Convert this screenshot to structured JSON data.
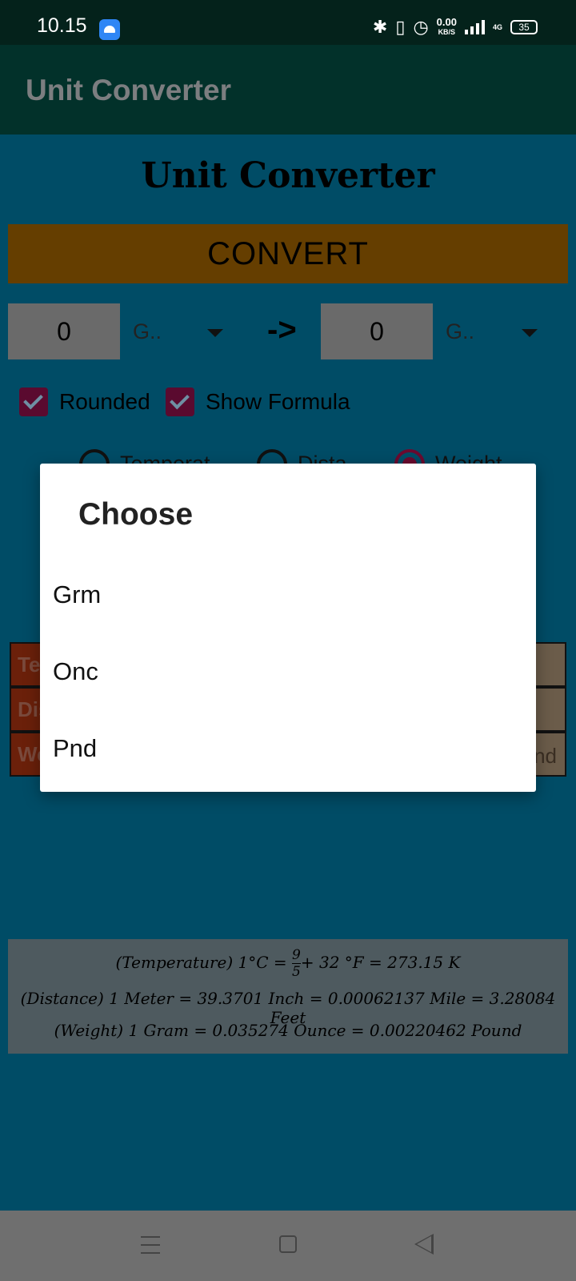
{
  "status_bar": {
    "time": "10.15",
    "speed_value": "0.00",
    "speed_unit": "KB/S",
    "network": "4G",
    "battery": "35",
    "icons": [
      "android-app-icon",
      "bluetooth-icon",
      "vibrate-icon",
      "alarm-icon",
      "signal-icon",
      "4g-signal-icon",
      "battery-icon"
    ]
  },
  "app_bar": {
    "title": "Unit Converter"
  },
  "main": {
    "heading": "Unit Converter",
    "convert_label": "CONVERT",
    "from_value": "0",
    "from_unit": "G..",
    "arrow": "->",
    "to_value": "0",
    "to_unit": "G..",
    "rounded_label": "Rounded",
    "rounded_checked": true,
    "show_formula_label": "Show Formula",
    "show_formula_checked": true,
    "radios": [
      {
        "label": "Temperat",
        "selected": false
      },
      {
        "label": "Dista",
        "selected": false
      },
      {
        "label": "Weight",
        "selected": true
      }
    ],
    "table_rows": [
      {
        "category": "Te",
        "value": ""
      },
      {
        "category": "Dis",
        "value": ""
      },
      {
        "category": "We",
        "value": "nd"
      }
    ],
    "formulas": {
      "temperature_prefix": "(Temperature)  1°C = ",
      "temperature_fraction_num": "9",
      "temperature_fraction_den": "5",
      "temperature_suffix": "+ 32 °F = 273.15 K",
      "distance": "(Distance) 1 Meter = 39.3701 Inch = 0.00062137 Mile =  3.28084 Feet",
      "weight": "(Weight) 1 Gram = 0.035274 Ounce = 0.00220462 Pound"
    }
  },
  "dialog": {
    "title": "Choose",
    "options": [
      "Grm",
      "Onc",
      "Pnd"
    ]
  },
  "colors": {
    "status_bar": "#04221b",
    "app_bar": "#02312a",
    "content_bg": "#004c66",
    "convert_button": "#653e00",
    "checkbox": "#5a0a2f",
    "dialog_bg": "#ffffff",
    "nav_bar": "#6f6f6f"
  }
}
